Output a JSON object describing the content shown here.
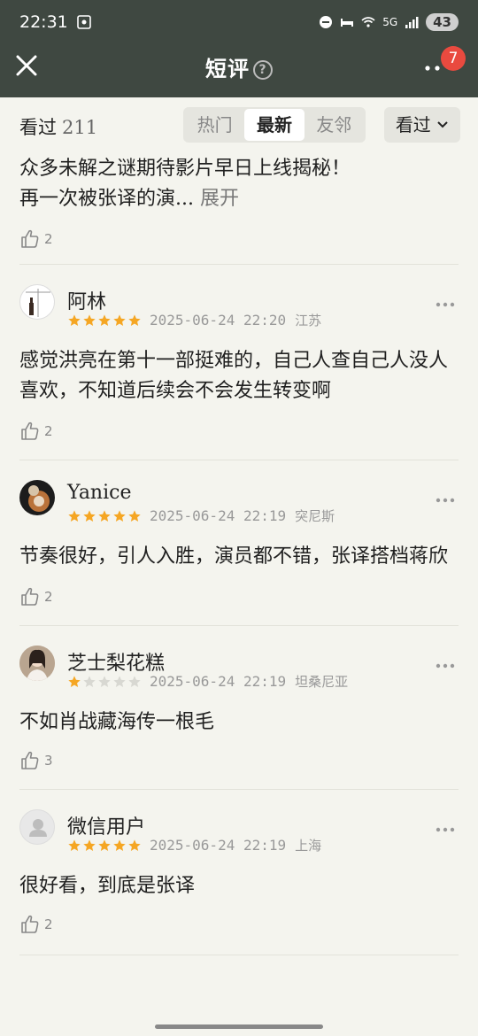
{
  "status_bar": {
    "time": "22:31",
    "battery": "43",
    "network": "5G"
  },
  "nav": {
    "title": "短评",
    "help": "?",
    "notification_count": "7"
  },
  "filter": {
    "seen_label": "看过",
    "seen_count": "211",
    "tabs": [
      "热门",
      "最新",
      "友邻"
    ],
    "active_tab": "最新",
    "seen_filter_label": "看过"
  },
  "comments": [
    {
      "text_lines": [
        "众多未解之谜期待影片早日上线揭秘！",
        "再一次被张译的演..."
      ],
      "expand_label": "展开",
      "likes": "2"
    },
    {
      "user": "阿林",
      "rating": 5,
      "date": "2025-06-24 22:20",
      "location": "江苏",
      "text": "感觉洪亮在第十一部挺难的，自己人查自己人没人喜欢，不知道后续会不会发生转变啊",
      "likes": "2"
    },
    {
      "user": "Yanice",
      "rating": 5,
      "date": "2025-06-24 22:19",
      "location": "突尼斯",
      "text": "节奏很好，引人入胜，演员都不错，张译搭档蒋欣",
      "likes": "2"
    },
    {
      "user": "芝士梨花糕",
      "rating": 1,
      "date": "2025-06-24 22:19",
      "location": "坦桑尼亚",
      "text": "不如肖战藏海传一根毛",
      "likes": "3"
    },
    {
      "user": "微信用户",
      "rating": 5,
      "date": "2025-06-24 22:19",
      "location": "上海",
      "text": "很好看，到底是张译",
      "likes": "2"
    }
  ],
  "colors": {
    "header_bg": "#3f4841",
    "page_bg": "#f4f4ee",
    "star": "#f5a623",
    "badge": "#e94a3f"
  }
}
